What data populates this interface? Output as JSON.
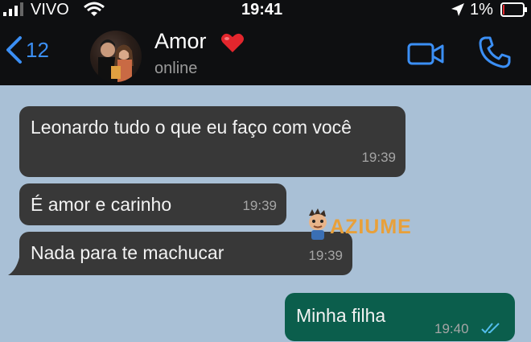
{
  "status_bar": {
    "carrier": "VIVO",
    "time": "19:41",
    "battery": "1%"
  },
  "header": {
    "back_count": "12",
    "contact_name": "Amor",
    "contact_status": "online"
  },
  "messages": [
    {
      "text": "Leonardo tudo o que eu faço com você",
      "time": "19:39",
      "direction": "incoming"
    },
    {
      "text": "É amor e carinho",
      "time": "19:39",
      "direction": "incoming"
    },
    {
      "text": "Nada para te machucar",
      "time": "19:39",
      "direction": "incoming"
    },
    {
      "text": "Minha filha",
      "time": "19:40",
      "direction": "outgoing"
    }
  ],
  "watermark": "AZIUME",
  "colors": {
    "accent": "#3b8ff5",
    "header_bg": "#0e0f11",
    "chat_bg": "#a9c0d6",
    "incoming_bubble": "#383838",
    "outgoing_bubble": "#0b5e4c",
    "heart": "#e3262d"
  }
}
